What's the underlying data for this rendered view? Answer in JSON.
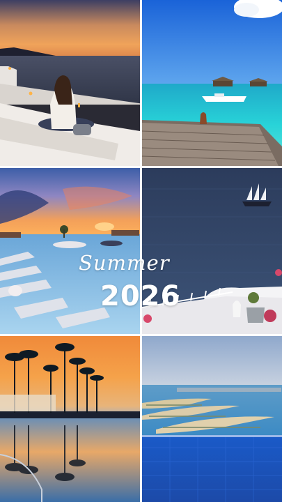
{
  "overlay": {
    "script_word": "Summer",
    "year": "2026"
  },
  "photos": [
    {
      "subject": "sunset-balcony"
    },
    {
      "subject": "overwater-villas-lagoon"
    },
    {
      "subject": "infinity-pool-sunset"
    },
    {
      "subject": "sailing-ship-sea"
    },
    {
      "subject": "palm-pool-sunset"
    },
    {
      "subject": "palm-islands-aerial"
    }
  ]
}
